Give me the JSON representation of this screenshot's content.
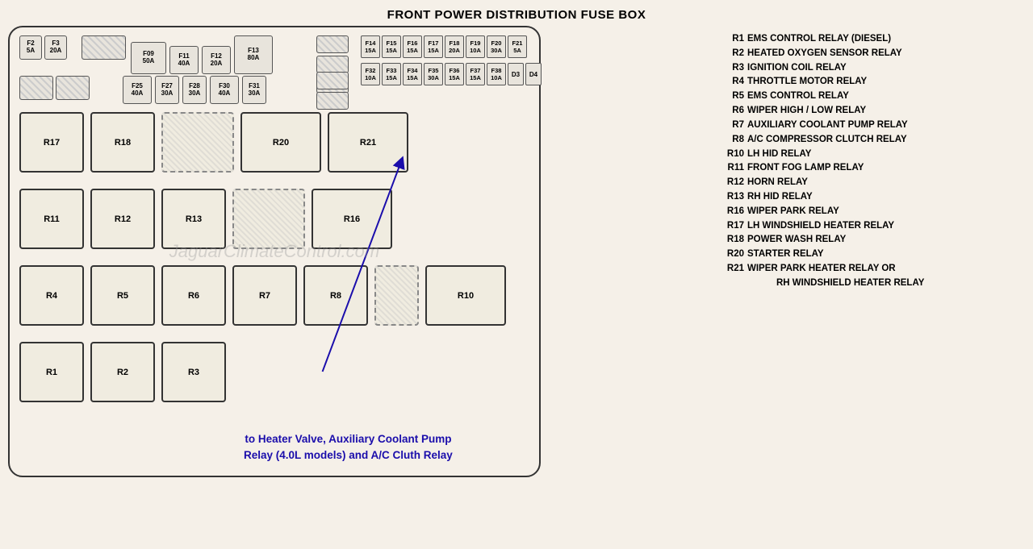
{
  "title": "FRONT POWER DISTRIBUTION FUSE BOX",
  "watermark": "JaguarClimateControl.com",
  "annotation": {
    "text_line1": "to Heater Valve, Auxiliary Coolant Pump",
    "text_line2": "Relay (4.0L models) and A/C Cluth Relay"
  },
  "fuses_top_left": [
    {
      "label": "F2",
      "sub": "5A"
    },
    {
      "label": "F3",
      "sub": "20A"
    }
  ],
  "fuses_mid": [
    {
      "label": "F09",
      "sub": "50A"
    },
    {
      "label": "F11",
      "sub": "40A"
    },
    {
      "label": "F12",
      "sub": "20A"
    },
    {
      "label": "F13",
      "sub": "80A"
    }
  ],
  "fuses_top_right_row1": [
    {
      "label": "F14",
      "sub": "15A"
    },
    {
      "label": "F15",
      "sub": "15A"
    },
    {
      "label": "F16",
      "sub": "15A"
    },
    {
      "label": "F17",
      "sub": "15A"
    },
    {
      "label": "F18",
      "sub": "20A"
    },
    {
      "label": "F19",
      "sub": "10A"
    },
    {
      "label": "F20",
      "sub": "30A"
    },
    {
      "label": "F21",
      "sub": "5A"
    }
  ],
  "fuses_top_right_row2": [
    {
      "label": "F32",
      "sub": "10A"
    },
    {
      "label": "F33",
      "sub": "15A"
    },
    {
      "label": "F34",
      "sub": "15A"
    },
    {
      "label": "F35",
      "sub": "30A"
    },
    {
      "label": "F36",
      "sub": "15A"
    },
    {
      "label": "F37",
      "sub": "15A"
    },
    {
      "label": "F38",
      "sub": "10A"
    },
    {
      "label": "D3",
      "is_d": true
    },
    {
      "label": "D4",
      "is_d": true
    }
  ],
  "fuses_second_row": [
    {
      "label": "F25",
      "sub": "40A"
    },
    {
      "label": "F27",
      "sub": "30A"
    },
    {
      "label": "F28",
      "sub": "30A"
    },
    {
      "label": "F30",
      "sub": "40A"
    },
    {
      "label": "F31",
      "sub": "30A"
    }
  ],
  "relays": {
    "row1": [
      "R17",
      "R18",
      "",
      "R20",
      "R21"
    ],
    "row2": [
      "R11",
      "R12",
      "R13",
      "",
      "R16"
    ],
    "row3": [
      "R4",
      "R5",
      "R6",
      "R7",
      "R8",
      "",
      "R10"
    ],
    "row4": [
      "R1",
      "R2",
      "R3"
    ]
  },
  "legend": [
    {
      "code": "R1",
      "desc": "EMS CONTROL RELAY (DIESEL)"
    },
    {
      "code": "R2",
      "desc": "HEATED OXYGEN SENSOR RELAY"
    },
    {
      "code": "R3",
      "desc": "IGNITION COIL RELAY"
    },
    {
      "code": "R4",
      "desc": "THROTTLE MOTOR RELAY"
    },
    {
      "code": "R5",
      "desc": "EMS CONTROL RELAY"
    },
    {
      "code": "R6",
      "desc": "WIPER HIGH / LOW RELAY"
    },
    {
      "code": "R7",
      "desc": "AUXILIARY COOLANT PUMP RELAY"
    },
    {
      "code": "R8",
      "desc": "A/C COMPRESSOR CLUTCH RELAY"
    },
    {
      "code": "R10",
      "desc": "LH HID RELAY"
    },
    {
      "code": "R11",
      "desc": "FRONT FOG LAMP RELAY"
    },
    {
      "code": "R12",
      "desc": "HORN RELAY"
    },
    {
      "code": "R13",
      "desc": "RH HID RELAY"
    },
    {
      "code": "R16",
      "desc": "WIPER PARK RELAY"
    },
    {
      "code": "R17",
      "desc": "LH WINDSHIELD HEATER RELAY"
    },
    {
      "code": "R18",
      "desc": "POWER WASH RELAY"
    },
    {
      "code": "R20",
      "desc": "STARTER RELAY"
    },
    {
      "code": "R21",
      "desc": "WIPER PARK HEATER RELAY OR"
    },
    {
      "code": "",
      "desc": "RH WINDSHIELD HEATER RELAY"
    }
  ]
}
